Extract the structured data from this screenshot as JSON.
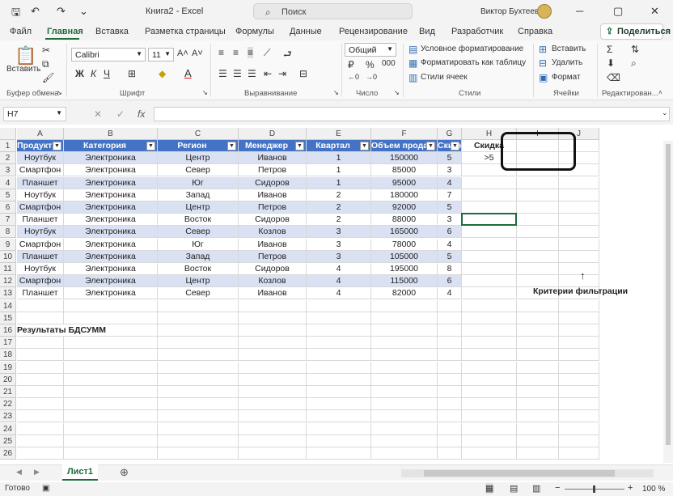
{
  "titlebar": {
    "title": "Книга2 - Excel",
    "search": "Поиск",
    "user": "Виктор Бухтеев"
  },
  "tabs": [
    "Файл",
    "Главная",
    "Вставка",
    "Разметка страницы",
    "Формулы",
    "Данные",
    "Рецензирование",
    "Вид",
    "Разработчик",
    "Справка"
  ],
  "share": "Поделиться",
  "ribbon": {
    "font_name": "Calibri",
    "font_size": "11",
    "number_format": "Общий",
    "paste": "Вставить",
    "groups": [
      "Буфер обмена",
      "Шрифт",
      "Выравнивание",
      "Число",
      "Стили",
      "Ячейки",
      "Редактирован..."
    ],
    "styles": [
      "Условное форматирование",
      "Форматировать как таблицу",
      "Стили ячеек"
    ],
    "cells": [
      "Вставить",
      "Удалить",
      "Формат"
    ],
    "font_buttons": [
      "Ж",
      "К",
      "Ч"
    ]
  },
  "namebox": "H7",
  "fx": "fx",
  "columns": [
    "A",
    "B",
    "C",
    "D",
    "E",
    "F",
    "G",
    "H",
    "I",
    "J"
  ],
  "headers": [
    "Продукт",
    "Категория",
    "Регион",
    "Менеджер",
    "Квартал",
    "Объем продаж",
    "Скидка"
  ],
  "rows": [
    [
      "Ноутбук",
      "Электроника",
      "Центр",
      "Иванов",
      "1",
      "150000",
      "5"
    ],
    [
      "Смартфон",
      "Электроника",
      "Север",
      "Петров",
      "1",
      "85000",
      "3"
    ],
    [
      "Планшет",
      "Электроника",
      "Юг",
      "Сидоров",
      "1",
      "95000",
      "4"
    ],
    [
      "Ноутбук",
      "Электроника",
      "Запад",
      "Иванов",
      "2",
      "180000",
      "7"
    ],
    [
      "Смартфон",
      "Электроника",
      "Центр",
      "Петров",
      "2",
      "92000",
      "5"
    ],
    [
      "Планшет",
      "Электроника",
      "Восток",
      "Сидоров",
      "2",
      "88000",
      "3"
    ],
    [
      "Ноутбук",
      "Электроника",
      "Север",
      "Козлов",
      "3",
      "165000",
      "6"
    ],
    [
      "Смартфон",
      "Электроника",
      "Юг",
      "Иванов",
      "3",
      "78000",
      "4"
    ],
    [
      "Планшет",
      "Электроника",
      "Запад",
      "Петров",
      "3",
      "105000",
      "5"
    ],
    [
      "Ноутбук",
      "Электроника",
      "Восток",
      "Сидоров",
      "4",
      "195000",
      "8"
    ],
    [
      "Смартфон",
      "Электроника",
      "Центр",
      "Козлов",
      "4",
      "115000",
      "6"
    ],
    [
      "Планшет",
      "Электроника",
      "Север",
      "Иванов",
      "4",
      "82000",
      "4"
    ]
  ],
  "criteria": {
    "header": "Скидка",
    "value": ">5",
    "label": "Критерии фильтрации"
  },
  "results_label": "Результаты БДСУММ",
  "sheet_tab": "Лист1",
  "status": {
    "ready": "Готово",
    "zoom": "100 %"
  }
}
